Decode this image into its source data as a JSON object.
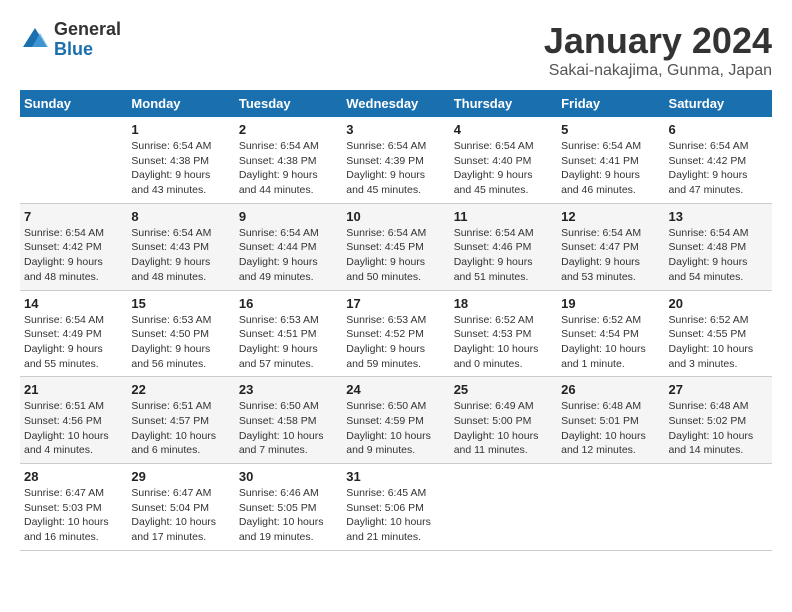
{
  "logo": {
    "general": "General",
    "blue": "Blue"
  },
  "title": "January 2024",
  "subtitle": "Sakai-nakajima, Gunma, Japan",
  "days_of_week": [
    "Sunday",
    "Monday",
    "Tuesday",
    "Wednesday",
    "Thursday",
    "Friday",
    "Saturday"
  ],
  "weeks": [
    [
      {
        "day": "",
        "info": ""
      },
      {
        "day": "1",
        "info": "Sunrise: 6:54 AM\nSunset: 4:38 PM\nDaylight: 9 hours\nand 43 minutes."
      },
      {
        "day": "2",
        "info": "Sunrise: 6:54 AM\nSunset: 4:38 PM\nDaylight: 9 hours\nand 44 minutes."
      },
      {
        "day": "3",
        "info": "Sunrise: 6:54 AM\nSunset: 4:39 PM\nDaylight: 9 hours\nand 45 minutes."
      },
      {
        "day": "4",
        "info": "Sunrise: 6:54 AM\nSunset: 4:40 PM\nDaylight: 9 hours\nand 45 minutes."
      },
      {
        "day": "5",
        "info": "Sunrise: 6:54 AM\nSunset: 4:41 PM\nDaylight: 9 hours\nand 46 minutes."
      },
      {
        "day": "6",
        "info": "Sunrise: 6:54 AM\nSunset: 4:42 PM\nDaylight: 9 hours\nand 47 minutes."
      }
    ],
    [
      {
        "day": "7",
        "info": "Sunrise: 6:54 AM\nSunset: 4:42 PM\nDaylight: 9 hours\nand 48 minutes."
      },
      {
        "day": "8",
        "info": "Sunrise: 6:54 AM\nSunset: 4:43 PM\nDaylight: 9 hours\nand 48 minutes."
      },
      {
        "day": "9",
        "info": "Sunrise: 6:54 AM\nSunset: 4:44 PM\nDaylight: 9 hours\nand 49 minutes."
      },
      {
        "day": "10",
        "info": "Sunrise: 6:54 AM\nSunset: 4:45 PM\nDaylight: 9 hours\nand 50 minutes."
      },
      {
        "day": "11",
        "info": "Sunrise: 6:54 AM\nSunset: 4:46 PM\nDaylight: 9 hours\nand 51 minutes."
      },
      {
        "day": "12",
        "info": "Sunrise: 6:54 AM\nSunset: 4:47 PM\nDaylight: 9 hours\nand 53 minutes."
      },
      {
        "day": "13",
        "info": "Sunrise: 6:54 AM\nSunset: 4:48 PM\nDaylight: 9 hours\nand 54 minutes."
      }
    ],
    [
      {
        "day": "14",
        "info": "Sunrise: 6:54 AM\nSunset: 4:49 PM\nDaylight: 9 hours\nand 55 minutes."
      },
      {
        "day": "15",
        "info": "Sunrise: 6:53 AM\nSunset: 4:50 PM\nDaylight: 9 hours\nand 56 minutes."
      },
      {
        "day": "16",
        "info": "Sunrise: 6:53 AM\nSunset: 4:51 PM\nDaylight: 9 hours\nand 57 minutes."
      },
      {
        "day": "17",
        "info": "Sunrise: 6:53 AM\nSunset: 4:52 PM\nDaylight: 9 hours\nand 59 minutes."
      },
      {
        "day": "18",
        "info": "Sunrise: 6:52 AM\nSunset: 4:53 PM\nDaylight: 10 hours\nand 0 minutes."
      },
      {
        "day": "19",
        "info": "Sunrise: 6:52 AM\nSunset: 4:54 PM\nDaylight: 10 hours\nand 1 minute."
      },
      {
        "day": "20",
        "info": "Sunrise: 6:52 AM\nSunset: 4:55 PM\nDaylight: 10 hours\nand 3 minutes."
      }
    ],
    [
      {
        "day": "21",
        "info": "Sunrise: 6:51 AM\nSunset: 4:56 PM\nDaylight: 10 hours\nand 4 minutes."
      },
      {
        "day": "22",
        "info": "Sunrise: 6:51 AM\nSunset: 4:57 PM\nDaylight: 10 hours\nand 6 minutes."
      },
      {
        "day": "23",
        "info": "Sunrise: 6:50 AM\nSunset: 4:58 PM\nDaylight: 10 hours\nand 7 minutes."
      },
      {
        "day": "24",
        "info": "Sunrise: 6:50 AM\nSunset: 4:59 PM\nDaylight: 10 hours\nand 9 minutes."
      },
      {
        "day": "25",
        "info": "Sunrise: 6:49 AM\nSunset: 5:00 PM\nDaylight: 10 hours\nand 11 minutes."
      },
      {
        "day": "26",
        "info": "Sunrise: 6:48 AM\nSunset: 5:01 PM\nDaylight: 10 hours\nand 12 minutes."
      },
      {
        "day": "27",
        "info": "Sunrise: 6:48 AM\nSunset: 5:02 PM\nDaylight: 10 hours\nand 14 minutes."
      }
    ],
    [
      {
        "day": "28",
        "info": "Sunrise: 6:47 AM\nSunset: 5:03 PM\nDaylight: 10 hours\nand 16 minutes."
      },
      {
        "day": "29",
        "info": "Sunrise: 6:47 AM\nSunset: 5:04 PM\nDaylight: 10 hours\nand 17 minutes."
      },
      {
        "day": "30",
        "info": "Sunrise: 6:46 AM\nSunset: 5:05 PM\nDaylight: 10 hours\nand 19 minutes."
      },
      {
        "day": "31",
        "info": "Sunrise: 6:45 AM\nSunset: 5:06 PM\nDaylight: 10 hours\nand 21 minutes."
      },
      {
        "day": "",
        "info": ""
      },
      {
        "day": "",
        "info": ""
      },
      {
        "day": "",
        "info": ""
      }
    ]
  ]
}
